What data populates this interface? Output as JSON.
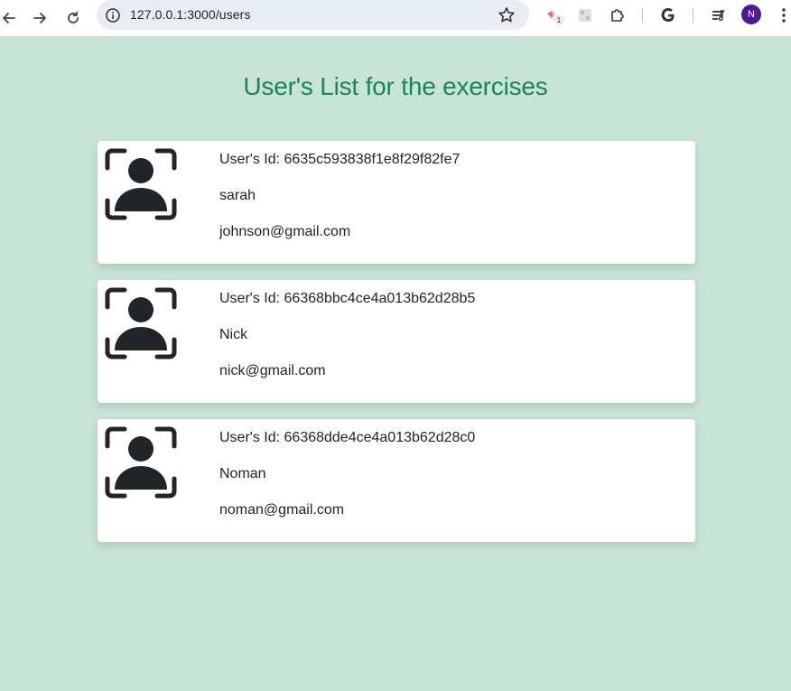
{
  "browser": {
    "url": "127.0.0.1:3000/users",
    "extension_badge": "1",
    "profile_initial": "N",
    "icons": [
      "back-icon",
      "forward-icon",
      "reload-icon",
      "site-info-icon",
      "bookmark-star-icon",
      "extension-puzzle-icon",
      "google-icon",
      "media-control-icon",
      "menu-kebab-icon"
    ]
  },
  "page": {
    "title": "User's List for the exercises",
    "title_color": "#198754",
    "background": "#c8e4d6"
  },
  "users": [
    {
      "id_line": "User's Id: 6635c593838f1e8f29f82fe7",
      "name": "sarah",
      "email": "johnson@gmail.com"
    },
    {
      "id_line": "User's Id: 66368bbc4ce4a013b62d28b5",
      "name": "Nick",
      "email": "nick@gmail.com"
    },
    {
      "id_line": "User's Id: 66368dde4ce4a013b62d28c0",
      "name": "Noman",
      "email": "noman@gmail.com"
    }
  ]
}
